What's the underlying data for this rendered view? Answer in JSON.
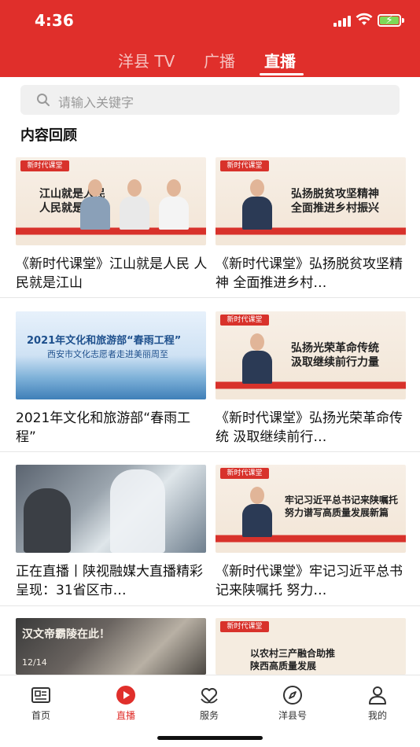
{
  "status": {
    "time": "4:36"
  },
  "tabs": [
    {
      "label": "洋县 TV"
    },
    {
      "label": "广播"
    },
    {
      "label": "直播"
    }
  ],
  "search": {
    "placeholder": "请输入关键字"
  },
  "section": {
    "title": "内容回顾"
  },
  "items": [
    {
      "title": "《新时代课堂》江山就是人民 人民就是江山",
      "thumb_text": [
        "江山就是人民",
        "人民就是江山"
      ]
    },
    {
      "title": "《新时代课堂》弘扬脱贫攻坚精神 全面推进乡村…",
      "thumb_text": [
        "弘扬脱贫攻坚精神",
        "全面推进乡村振兴"
      ]
    },
    {
      "title": "2021年文化和旅游部“春雨工程”",
      "thumb_text": [
        "2021年文化和旅游部“春雨工程”",
        "西安市文化志愿者走进美丽周至"
      ]
    },
    {
      "title": "《新时代课堂》弘扬光荣革命传统 汲取继续前行…",
      "thumb_text": [
        "弘扬光荣革命传统",
        "汲取继续前行力量"
      ]
    },
    {
      "title": "正在直播丨陕视融媒大直播精彩呈现：31省区市…",
      "thumb_text": []
    },
    {
      "title": "《新时代课堂》牢记习近平总书记来陕嘱托 努力…",
      "thumb_text": [
        "牢记习近平总书记来陕嘱托",
        "努力谱写高质量发展新篇"
      ]
    },
    {
      "title": "",
      "thumb_text": [
        "汉文帝霸陵在此！",
        "12/14"
      ]
    },
    {
      "title": "",
      "thumb_text": [
        "以农村三产融合助推",
        "陕西高质量发展"
      ]
    }
  ],
  "badge": {
    "label": "新时代课堂"
  },
  "nav": [
    {
      "label": "首页",
      "icon": "news-icon"
    },
    {
      "label": "直播",
      "icon": "live-play-icon"
    },
    {
      "label": "服务",
      "icon": "service-heart-icon"
    },
    {
      "label": "洋县号",
      "icon": "compass-icon"
    },
    {
      "label": "我的",
      "icon": "user-icon"
    }
  ],
  "colors": {
    "brand": "#e02f2b",
    "active_nav": "#e02f2b"
  }
}
